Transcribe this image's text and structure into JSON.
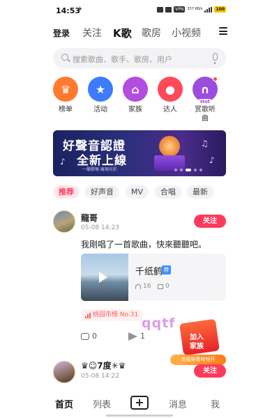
{
  "status_bar": {
    "time": "14:53",
    "vpn": "VPN",
    "speed": "337 KB/s",
    "battery": "100"
  },
  "top_nav": {
    "login": "登录",
    "tabs": [
      "关注",
      "K歌",
      "歌房",
      "小视频"
    ],
    "active_tab": "K歌"
  },
  "search": {
    "placeholder": "搜索歌曲、歌手、歌房、用户"
  },
  "categories": [
    {
      "label": "榜单",
      "color": "#ff7a2e",
      "icon": "crown-icon"
    },
    {
      "label": "活动",
      "color": "#3d7bff",
      "icon": "star-icon"
    },
    {
      "label": "家族",
      "color": "#b24de0",
      "icon": "home-icon"
    },
    {
      "label": "达人",
      "color": "#ff4a5a",
      "icon": "person-check-icon"
    },
    {
      "label": "赏歌听曲",
      "color": "#9b4de0",
      "icon": "headphone-icon",
      "badge": "Hot"
    }
  ],
  "banner": {
    "line1": "好聲音認證",
    "line2": "全新上線",
    "sub": "一聽歌喉 展現光彩"
  },
  "chips": [
    {
      "label": "推荐",
      "active": true
    },
    {
      "label": "好声音",
      "active": false
    },
    {
      "label": "MV",
      "active": false
    },
    {
      "label": "合唱",
      "active": false
    },
    {
      "label": "最新",
      "active": false
    }
  ],
  "post1": {
    "username": "龍哥",
    "time": "05-08 14:23",
    "follow_label": "关注",
    "text": "我剛唱了一首歌曲，快來聽聽吧。",
    "song": {
      "title": "千纸鹤",
      "badge": "荐",
      "plays": "16",
      "gifts": "0"
    },
    "rank": "桃园市榜 No.31",
    "comments": "0",
    "shares": "1"
  },
  "watermark": "qqtf",
  "promo": {
    "line1": "加入",
    "line2": "家族",
    "strip": "龙福穿斎咁咁开"
  },
  "post2": {
    "username": "♛☺7度✳♛",
    "time": "05-08 14:22",
    "follow_label": "关注"
  },
  "bottom_nav": {
    "items": [
      "首页",
      "列表",
      "消息",
      "我"
    ],
    "active": "首页"
  }
}
